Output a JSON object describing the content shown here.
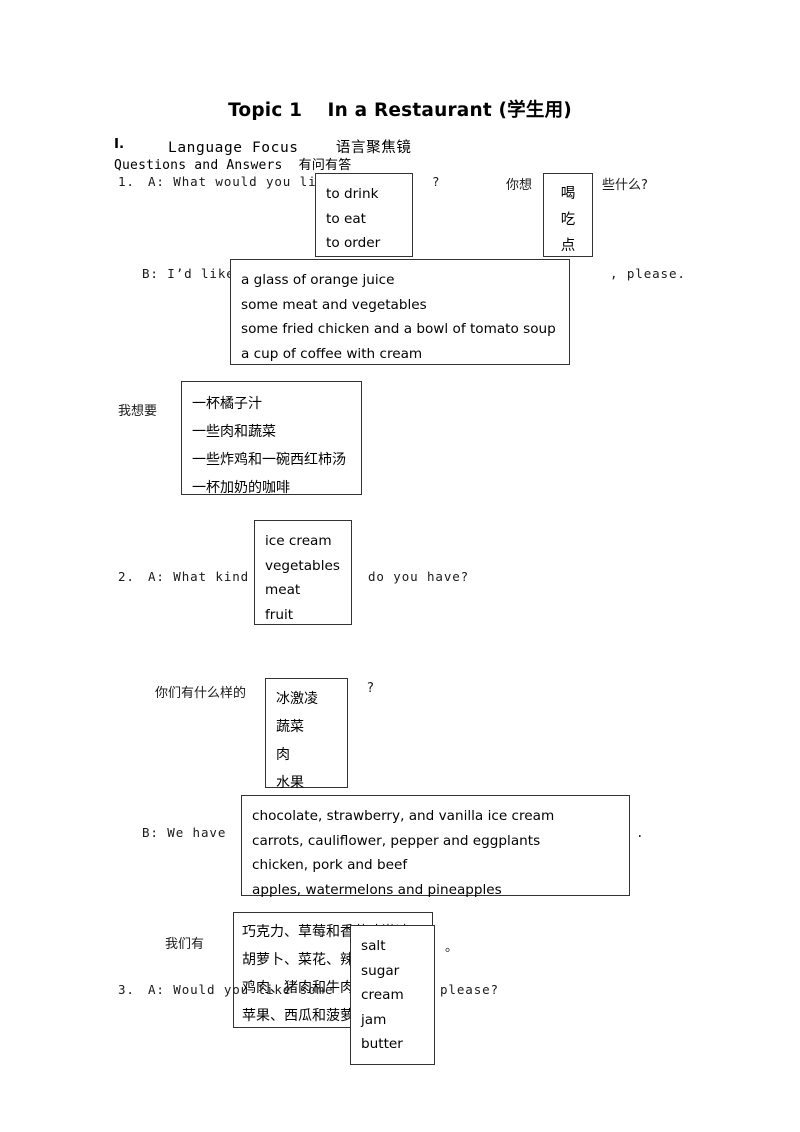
{
  "page": {
    "title": "Topic 1　 In a Restaurant (学生用)",
    "section_number": "I.",
    "section_title": "Language Focus    语言聚焦镜",
    "section_subtitle": "Questions and Answers  有问有答"
  },
  "q1": {
    "number": "1.",
    "en_lead": "A: What would you like",
    "en_tail": "?",
    "cn_lead": "你想",
    "cn_tail": "些什么?",
    "verbs_en": [
      "to drink",
      "to eat",
      "to order"
    ],
    "verbs_cn": [
      "喝",
      "吃",
      "点"
    ],
    "answer_en_lead": "B: I’d like",
    "answer_en_tail": ", please.",
    "answer_cn_lead": "我想要",
    "answers_en": [
      "a glass of orange juice",
      "some meat and vegetables",
      "some fried chicken and a bowl of tomato soup",
      "a cup of coffee with cream"
    ],
    "answers_cn": [
      "一杯橘子汁",
      "一些肉和蔬菜",
      "一些炸鸡和一碗西红柿汤",
      "一杯加奶的咖啡"
    ]
  },
  "q2": {
    "number": "2.",
    "en_lead": "A: What kind of",
    "en_tail": "do you have?",
    "cn_lead": "你们有什么样的",
    "cn_tail": "?",
    "kinds_en": [
      "ice cream",
      "vegetables",
      "meat",
      "fruit"
    ],
    "kinds_cn": [
      "冰激凌",
      "蔬菜",
      "肉",
      "水果"
    ],
    "answer_en_lead": "B: We have",
    "answer_en_tail": ".",
    "answer_cn_lead": "我们有",
    "answer_cn_tail": "。",
    "answers_en": [
      "chocolate, strawberry, and vanilla ice cream",
      "carrots, cauliflower, pepper and eggplants",
      "chicken, pork and beef",
      "apples, watermelons and pineapples"
    ],
    "answers_cn": [
      "巧克力、草莓和香草冰激凌",
      "胡萝卜、菜花、辣椒和茄子",
      "鸡肉、猪肉和牛肉",
      "苹果、西瓜和菠萝"
    ]
  },
  "q3": {
    "number": "3.",
    "en_lead": "A: Would you like some",
    "en_tail": "please?",
    "items_en": [
      "salt",
      "sugar",
      "cream",
      "jam",
      "butter"
    ]
  }
}
